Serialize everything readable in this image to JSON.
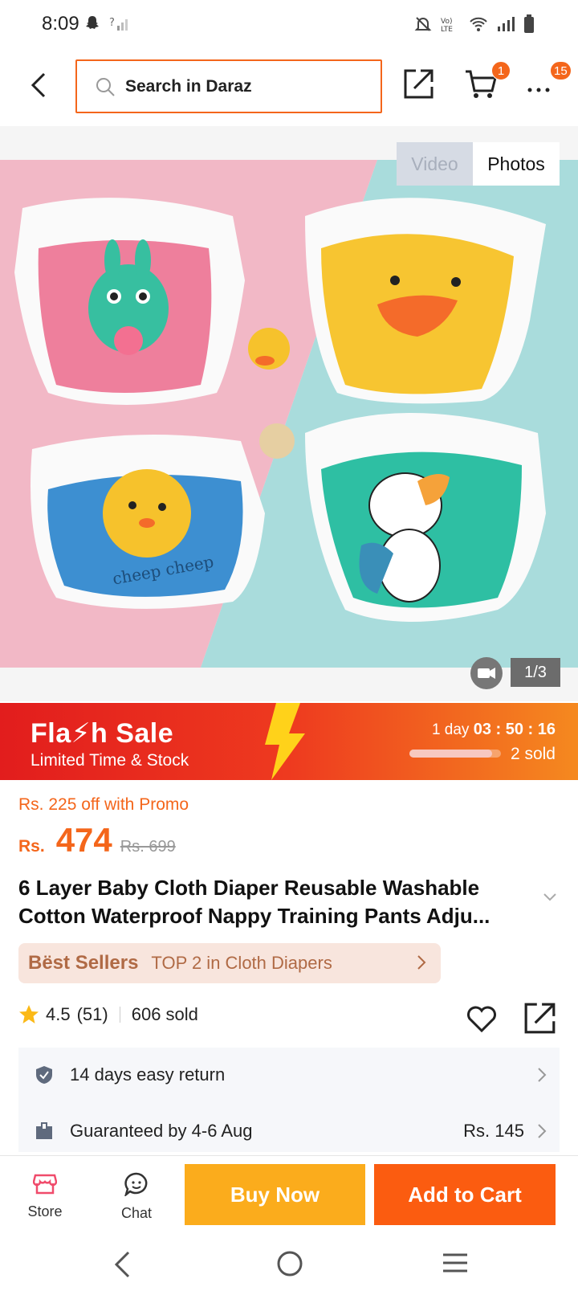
{
  "status_bar": {
    "time": "8:09",
    "signal_small": "?"
  },
  "search": {
    "placeholder": "Search in Daraz"
  },
  "topbar": {
    "cart_badge": "1",
    "more_badge": "15"
  },
  "gallery": {
    "tabs": [
      {
        "label": "Video",
        "selected": false
      },
      {
        "label": "Photos",
        "selected": true
      }
    ],
    "counter": "1/3",
    "image_description_icon": "product-photo"
  },
  "flash_sale": {
    "title": "Fla⚡h  Sale",
    "subtitle": "Limited Time & Stock",
    "timer_prefix": "1 day",
    "timer": "03 : 50 : 16",
    "sold": "2 sold",
    "sold_progress": 0.9
  },
  "price": {
    "promo": "Rs. 225 off with Promo",
    "currency": "Rs.",
    "value": "474",
    "original": "Rs. 699"
  },
  "product": {
    "title": "6 Layer Baby Cloth Diaper Reusable Washable Cotton Waterproof Nappy Training Pants Adju..."
  },
  "best_sellers": {
    "label": "Bëst Sellers",
    "rank": "TOP 2 in Cloth Diapers"
  },
  "rating": {
    "value": "4.5",
    "count": "(51)",
    "sold": "606 sold"
  },
  "info": {
    "return": "14 days easy return",
    "delivery": "Guaranteed by 4-6 Aug",
    "delivery_fee": "Rs. 145"
  },
  "actions": {
    "store": "Store",
    "chat": "Chat",
    "buy_now": "Buy Now",
    "add_to_cart": "Add to Cart"
  },
  "colors": {
    "accent": "#f4661b",
    "buy": "#fbac1c",
    "cart": "#fb5c10"
  }
}
